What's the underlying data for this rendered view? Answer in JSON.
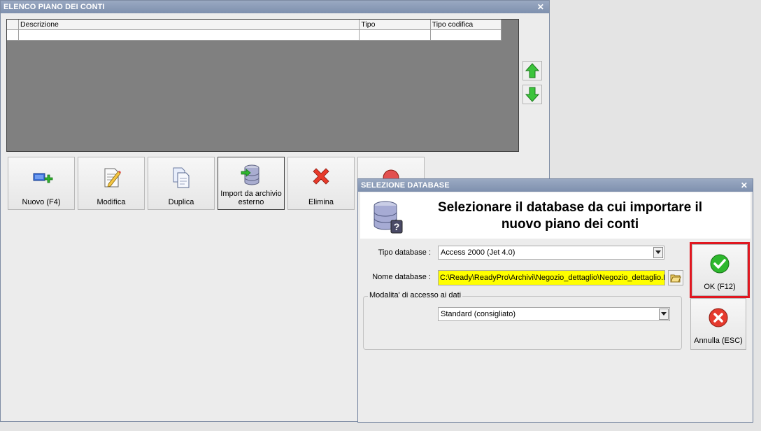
{
  "main_window": {
    "title": "ELENCO PIANO DEI CONTI",
    "close_glyph": "✕",
    "grid": {
      "columns": [
        "Descrizione",
        "Tipo",
        "Tipo codifica"
      ]
    },
    "toolbar": [
      {
        "name": "nuovo-button",
        "label": "Nuovo (F4)",
        "icon": "add-record-icon"
      },
      {
        "name": "modifica-button",
        "label": "Modifica",
        "icon": "edit-document-icon"
      },
      {
        "name": "duplica-button",
        "label": "Duplica",
        "icon": "duplicate-document-icon"
      },
      {
        "name": "import-button",
        "label": "Import da archivio esterno",
        "icon": "database-import-icon"
      },
      {
        "name": "elimina-button",
        "label": "Elimina",
        "icon": "delete-x-icon"
      }
    ]
  },
  "dialog": {
    "title": "SELEZIONE DATABASE",
    "close_glyph": "✕",
    "header_text": "Selezionare il database da cui importare il nuovo piano dei conti",
    "tipo_label": "Tipo database :",
    "tipo_value": "Access 2000 (Jet 4.0)",
    "nome_label": "Nome database :",
    "nome_value": "C:\\Ready\\ReadyPro\\Archivi\\Negozio_dettaglio\\Negozio_dettaglio.R",
    "group_label": "Modalita' di accesso ai dati",
    "accesso_value": "Standard (consigliato)",
    "ok_label": "OK (F12)",
    "annulla_label": "Annulla (ESC)"
  },
  "colors": {
    "title_bar": "#8a9bb8",
    "highlight": "#e0161f",
    "field_yellow": "#ffff00",
    "grid_bg": "#808080"
  }
}
